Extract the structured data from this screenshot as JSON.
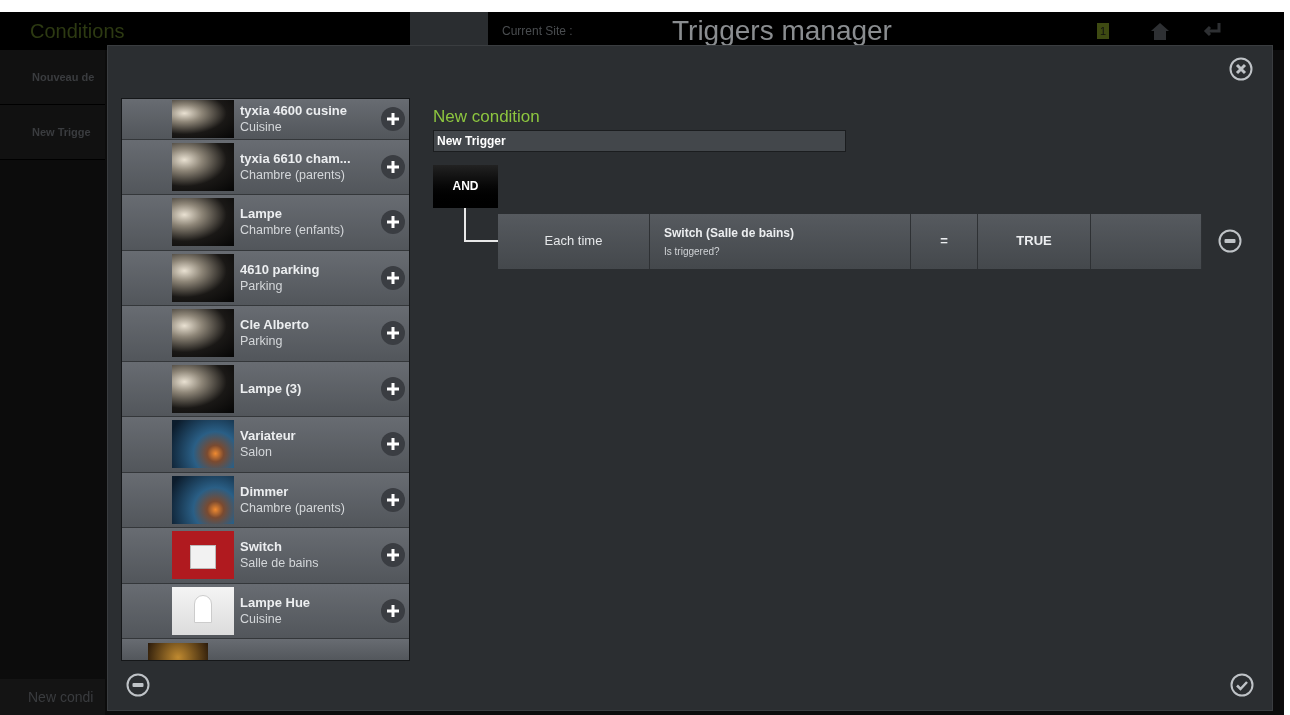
{
  "background": {
    "title": "Conditions",
    "site_label": "Current Site :",
    "page_title": "Triggers manager",
    "badge": "1",
    "sidebar_items": [
      "Nouveau de",
      "New Trigge"
    ],
    "footer_item": "New condi"
  },
  "devices": [
    {
      "name": "tyxia 4600  cusine",
      "room": "Cuisine",
      "kind": "spot",
      "partial": true
    },
    {
      "name": "tyxia 6610  cham...",
      "room": "Chambre (parents)",
      "kind": "spot",
      "partial": false
    },
    {
      "name": "Lampe",
      "room": "Chambre (enfants)",
      "kind": "spot",
      "partial": false
    },
    {
      "name": "4610 parking",
      "room": "Parking",
      "kind": "spot",
      "partial": false
    },
    {
      "name": "Cle Alberto",
      "room": "Parking",
      "kind": "spot",
      "partial": false
    },
    {
      "name": "Lampe (3)",
      "kind": "spot",
      "partial": false
    },
    {
      "name": "Variateur",
      "room": "Salon",
      "kind": "smoke",
      "partial": false
    },
    {
      "name": "Dimmer",
      "room": "Chambre (parents)",
      "kind": "smoke",
      "partial": false
    },
    {
      "name": "Switch",
      "room": "Salle de bains",
      "kind": "switch",
      "partial": false
    },
    {
      "name": "Lampe Hue",
      "room": "Cuisine",
      "kind": "bulb",
      "partial": false
    }
  ],
  "editor": {
    "heading": "New condition",
    "name_value": "New Trigger",
    "operator": "AND",
    "conditions": [
      {
        "cells": [
          {
            "kind": "plain",
            "text": "Each time"
          },
          {
            "kind": "device",
            "text": "Switch (Salle de bains)",
            "subtext": "Is triggered?"
          },
          {
            "kind": "operator",
            "text": "="
          },
          {
            "kind": "value",
            "text": "TRUE"
          },
          {
            "kind": "empty"
          }
        ]
      }
    ]
  }
}
